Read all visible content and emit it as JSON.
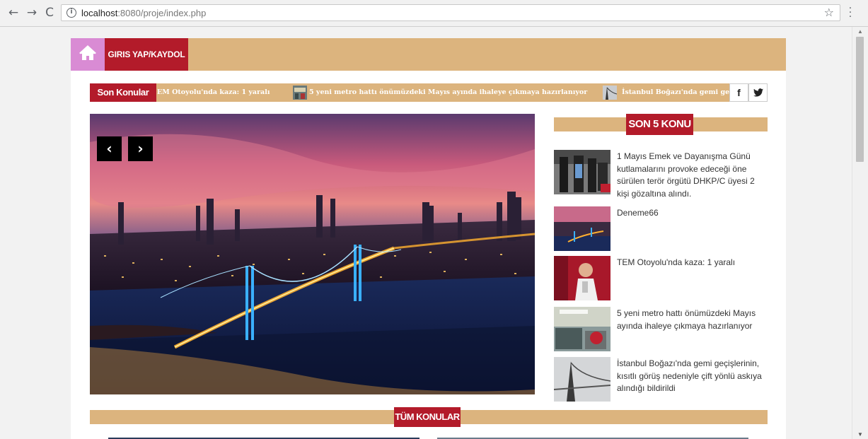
{
  "browser": {
    "url_host": "localhost",
    "url_rest": ":8080/proje/index.php"
  },
  "nav": {
    "login_label": "GIRIS YAP/KAYDOL"
  },
  "ticker": {
    "label": "Son Konular",
    "items": [
      "EM Otoyolu'nda kaza: 1 yaralı",
      "5 yeni metro hattı önümüzdeki Mayıs ayında ihaleye çıkmaya hazırlanıyor",
      "İstanbul Boğazı'nda gemi geçe"
    ]
  },
  "sidebar": {
    "title": "SON 5 KONU",
    "items": [
      {
        "text": "1 Mayıs Emek ve Dayanışma Günü kutlamalarını provoke edeceği öne sürülen terör örgütü DHKP/C üyesi 2 kişi gözaltına alındı."
      },
      {
        "text": "Deneme66"
      },
      {
        "text": "TEM Otoyolu'nda kaza: 1 yaralı"
      },
      {
        "text": "5 yeni metro hattı önümüzdeki Mayıs ayında ihaleye çıkmaya hazırlanıyor"
      },
      {
        "text": "İstanbul Boğazı'nda gemi geçişlerinin, kısıtlı görüş nedeniyle çift yönlü askıya alındığı bildirildi"
      }
    ]
  },
  "all_topics": {
    "title": "TÜM KONULAR"
  },
  "colors": {
    "accent_red": "#b31b2a",
    "tan": "#dcb47e",
    "home_pink": "#d98bd4"
  }
}
